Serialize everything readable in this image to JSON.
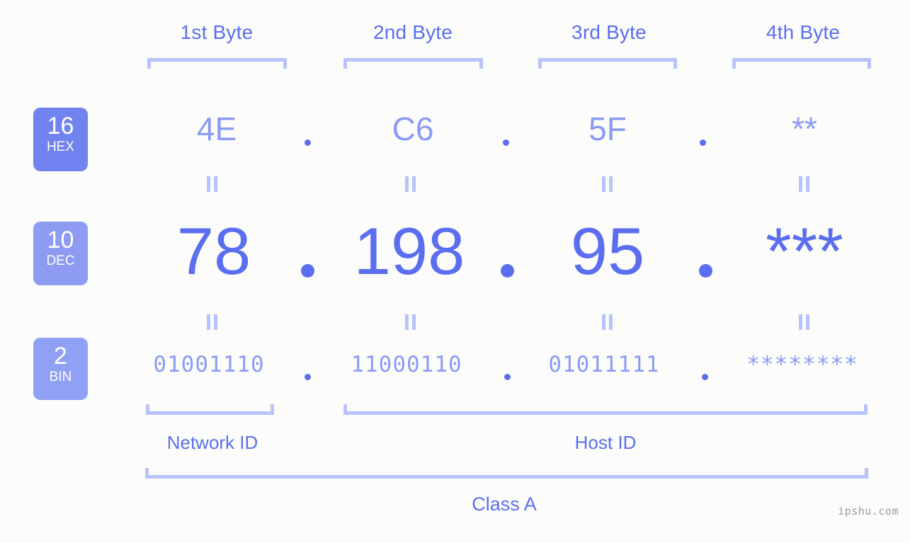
{
  "theme": {
    "background": "#fcfdfa",
    "accent_strong": "#5b6ef0",
    "accent_light": "#8b9bf3",
    "bracket": "#b8c2fb",
    "badge_hex_bg": "#7183ef",
    "badge_dec_bg": "#8d9bf3",
    "badge_bin_bg": "#90a0f5",
    "watermark_color": "#9a9a9a"
  },
  "byte_headers": [
    {
      "label": "1st Byte"
    },
    {
      "label": "2nd Byte"
    },
    {
      "label": "3rd Byte"
    },
    {
      "label": "4th Byte"
    }
  ],
  "radix_badges": [
    {
      "number": "16",
      "name": "HEX"
    },
    {
      "number": "10",
      "name": "DEC"
    },
    {
      "number": "2",
      "name": "BIN"
    }
  ],
  "rows": {
    "hex": {
      "values": [
        "4E",
        "C6",
        "5F",
        "**"
      ]
    },
    "dec": {
      "values": [
        "78",
        "198",
        "95",
        "***"
      ]
    },
    "bin": {
      "values": [
        "01001110",
        "11000110",
        "01011111",
        "********"
      ]
    }
  },
  "separators": {
    "dot": "."
  },
  "equals_symbol": "=",
  "segments": {
    "network_id": "Network ID",
    "host_id": "Host ID",
    "class": "Class A"
  },
  "watermark": "ipshu.com"
}
